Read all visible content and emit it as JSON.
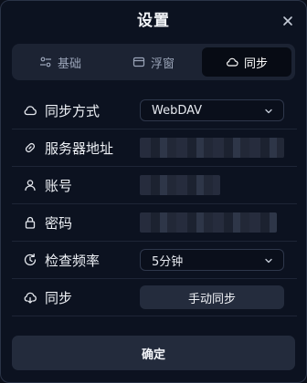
{
  "dialog": {
    "title": "设置",
    "close_icon": "close-icon"
  },
  "tabs": [
    {
      "label": "基础",
      "icon": "sliders-icon",
      "active": false
    },
    {
      "label": "浮窗",
      "icon": "window-icon",
      "active": false
    },
    {
      "label": "同步",
      "icon": "cloud-icon",
      "active": true
    }
  ],
  "settings": {
    "sync_method": {
      "label": "同步方式",
      "icon": "cloud-icon",
      "value": "WebDAV"
    },
    "server_address": {
      "label": "服务器地址",
      "icon": "link-icon"
    },
    "account": {
      "label": "账号",
      "icon": "user-icon"
    },
    "password": {
      "label": "密码",
      "icon": "lock-icon"
    },
    "check_frequency": {
      "label": "检查频率",
      "icon": "clock-refresh-icon",
      "value": "5分钟"
    },
    "sync": {
      "label": "同步",
      "icon": "cloud-download-icon",
      "button_label": "手动同步"
    }
  },
  "footer": {
    "confirm_label": "确定"
  }
}
